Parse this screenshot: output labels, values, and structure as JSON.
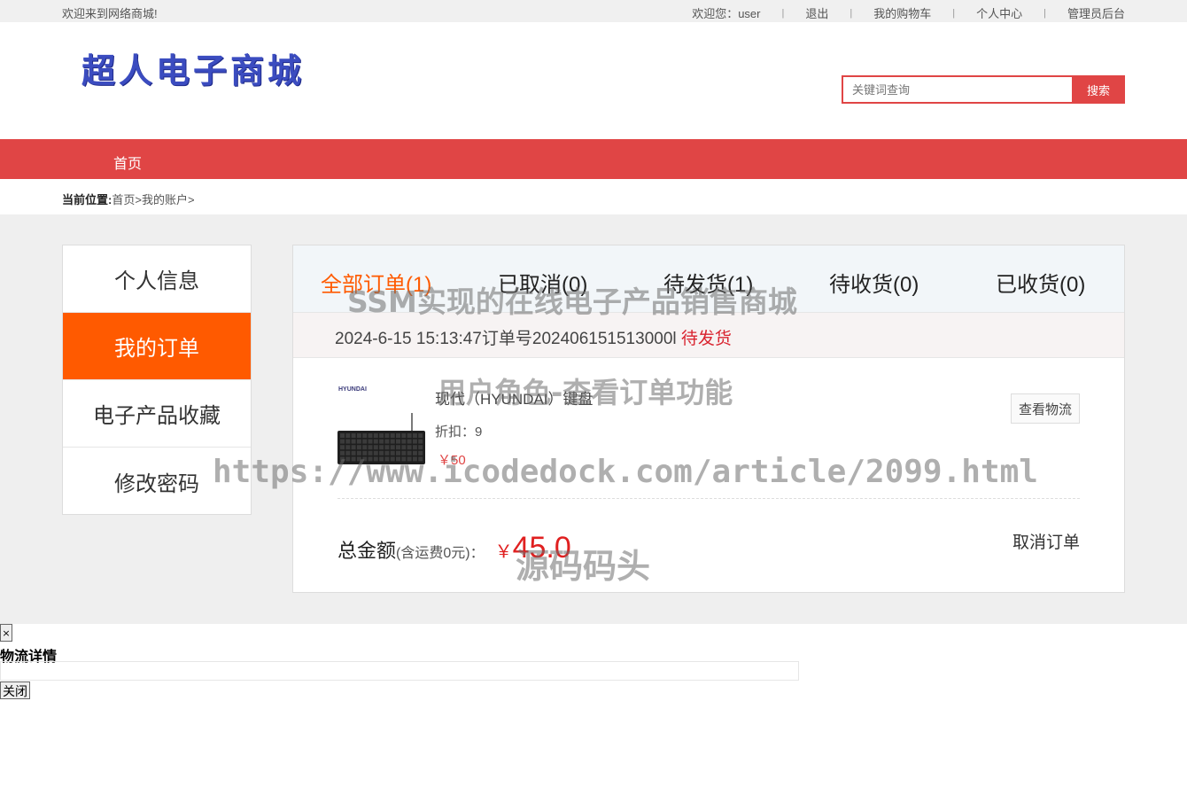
{
  "topbar": {
    "welcome": "欢迎来到网络商城!",
    "greeting": "欢迎您：user",
    "sep": "|",
    "logout": "退出",
    "cart": "我的购物车",
    "profile": "个人中心",
    "admin": "管理员后台"
  },
  "header": {
    "logo_text": "超人电子商城",
    "search_placeholder": "关键词查询",
    "search_button": "搜索"
  },
  "nav": {
    "home": "首页"
  },
  "breadcrumb": {
    "label": "当前位置:",
    "home": "首页",
    "sep": ">",
    "account": "我的账户"
  },
  "sidebar": {
    "items": [
      {
        "label": "个人信息"
      },
      {
        "label": "我的订单"
      },
      {
        "label": "电子产品收藏"
      },
      {
        "label": "修改密码"
      }
    ]
  },
  "tabs": [
    {
      "label": "全部订单(1)"
    },
    {
      "label": "已取消(0)"
    },
    {
      "label": "待发货(1)"
    },
    {
      "label": "待收货(0)"
    },
    {
      "label": "已收货(0)"
    }
  ],
  "order": {
    "datetime": "2024-6-15 15:13:47",
    "number_label": "订单号",
    "number": "202406151513000l",
    "status": "待发货",
    "product": {
      "brand_logo": "HYUNDAI",
      "name": "现代（HYUNDAI）键盘",
      "discount": "折扣：9",
      "price": "￥50"
    },
    "logistics_button": "查看物流",
    "total_label": "总金额",
    "shipping_note": "(含运费0元)：",
    "currency": "￥",
    "total_amount": "45.0",
    "cancel_label": "取消订单"
  },
  "modal": {
    "close_x": "×",
    "title": "物流详情",
    "close_button": "关闭"
  },
  "watermarks": {
    "line1": "SSM实现的在线电子产品销售商城",
    "line2": "用户角色-查看订单功能",
    "line3": "https://www.icodedock.com/article/2099.html",
    "line4": "源码码头"
  },
  "colors": {
    "brand_red": "#e04545",
    "active_orange": "#ff5a00",
    "price_red": "#e02020",
    "logo_blue": "#3b4cc0"
  }
}
